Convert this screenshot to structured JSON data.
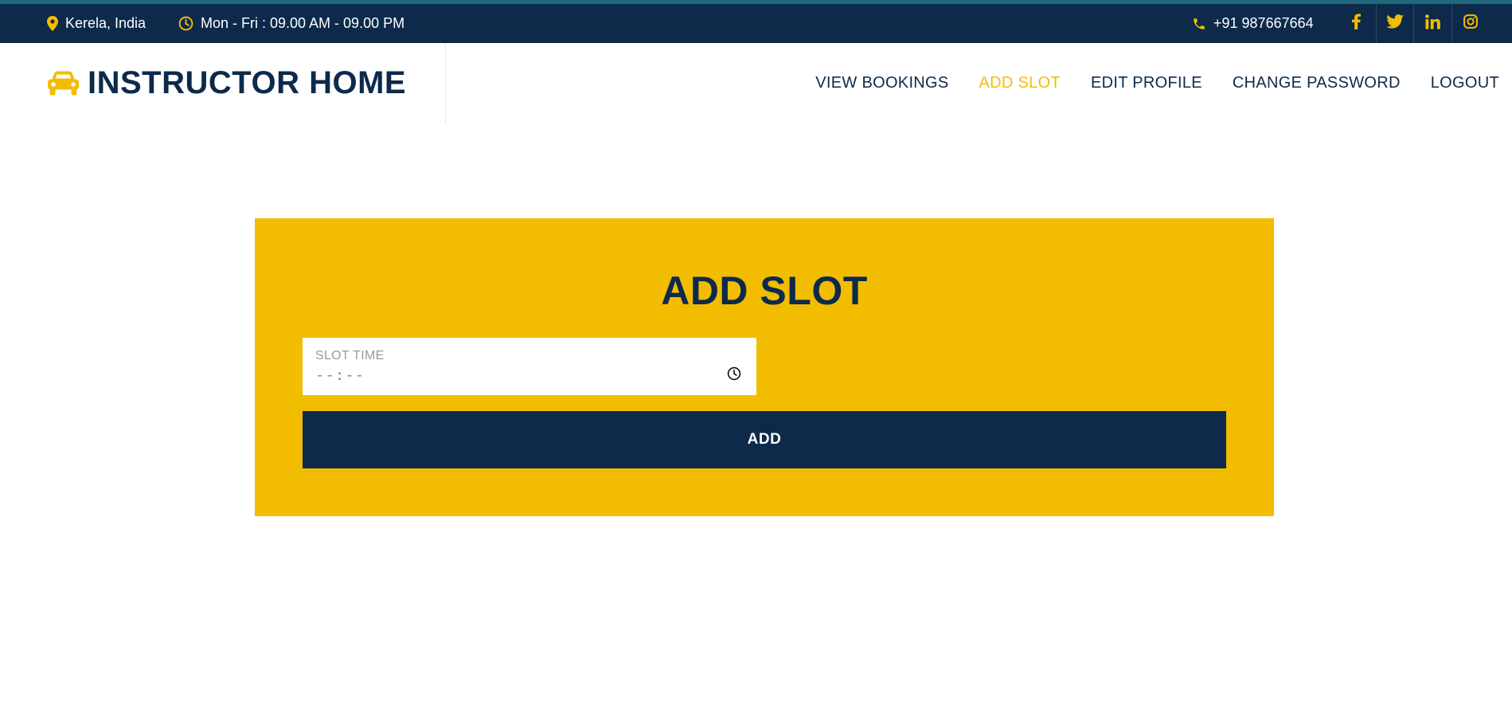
{
  "topbar": {
    "location": "Kerela, India",
    "hours": "Mon - Fri : 09.00 AM - 09.00 PM",
    "phone": "+91 987667664",
    "socials": [
      "facebook-icon",
      "twitter-icon",
      "linkedin-icon",
      "instagram-icon"
    ]
  },
  "header": {
    "brand": "INSTRUCTOR HOME",
    "brand_icon": "car-icon",
    "nav": [
      {
        "label": "VIEW BOOKINGS",
        "active": false
      },
      {
        "label": "ADD SLOT",
        "active": true
      },
      {
        "label": "EDIT PROFILE",
        "active": false
      },
      {
        "label": "CHANGE PASSWORD",
        "active": false
      },
      {
        "label": "LOGOUT",
        "active": false
      }
    ]
  },
  "form": {
    "title": "ADD SLOT",
    "slot_label": "SLOT TIME",
    "slot_value": "--:--",
    "submit_label": "ADD"
  },
  "colors": {
    "navy": "#0d2a4b",
    "accent": "#f2bd00",
    "white": "#ffffff"
  }
}
